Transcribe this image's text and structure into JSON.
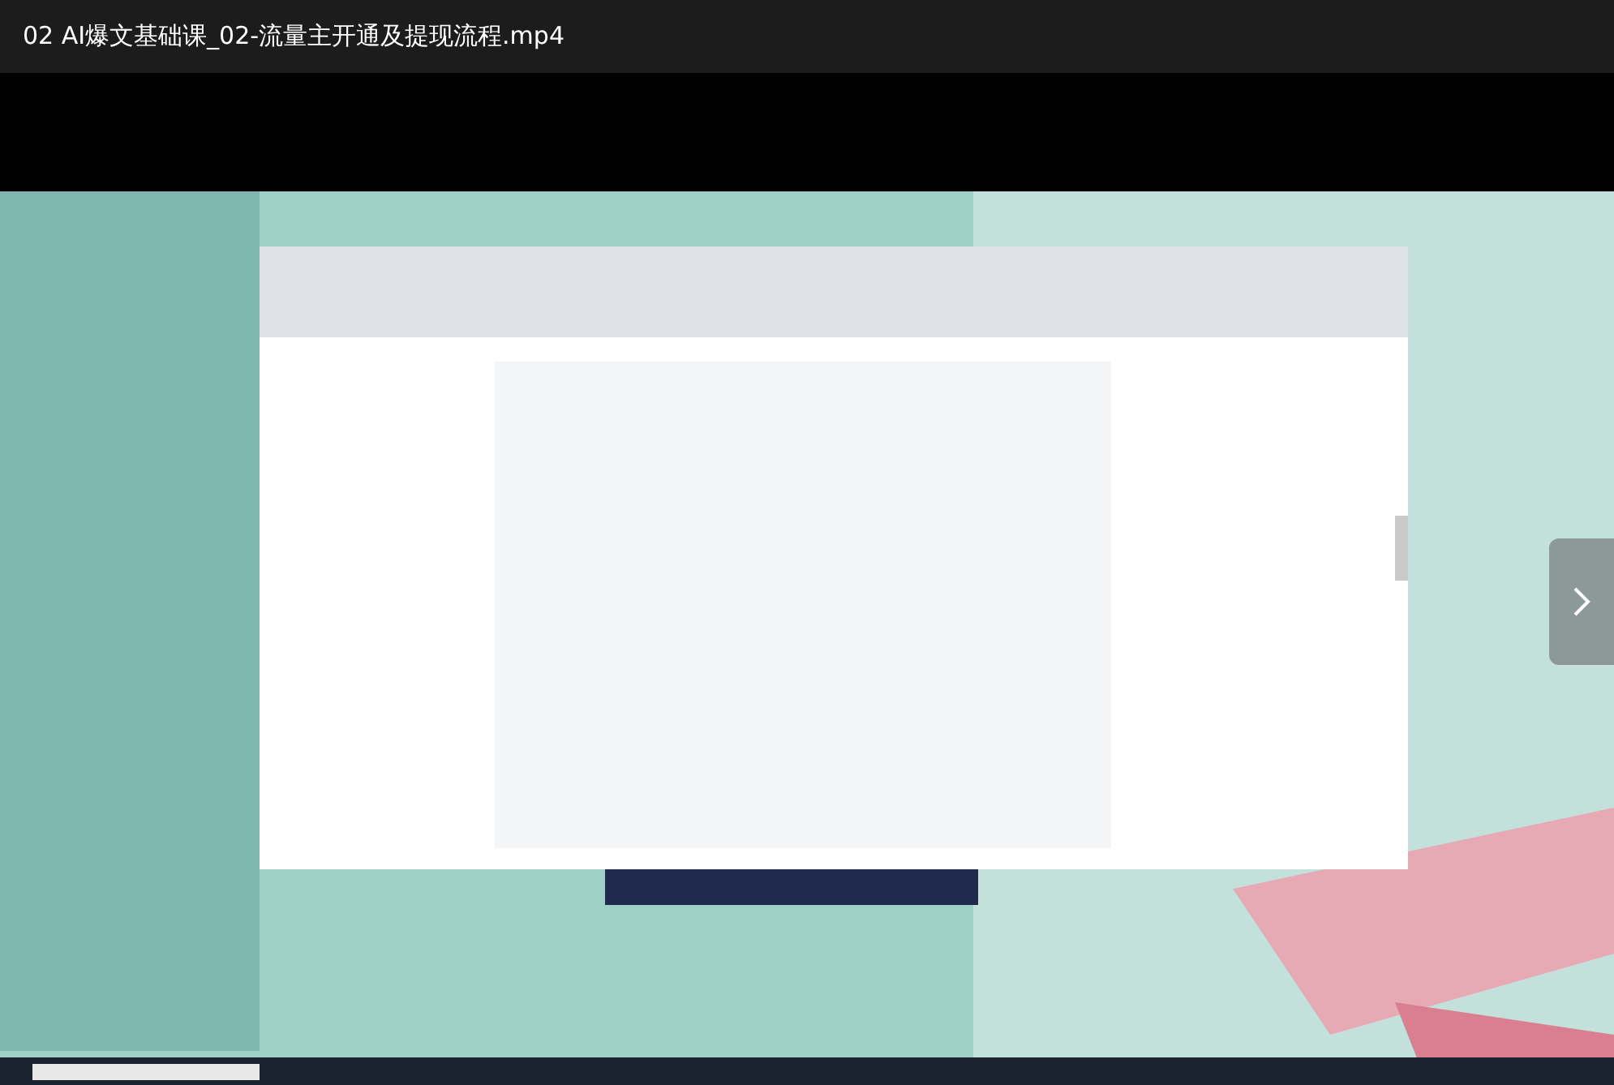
{
  "window": {
    "title": "02 AI爆文基础课_02-流量主开通及提现流程.mp4"
  }
}
